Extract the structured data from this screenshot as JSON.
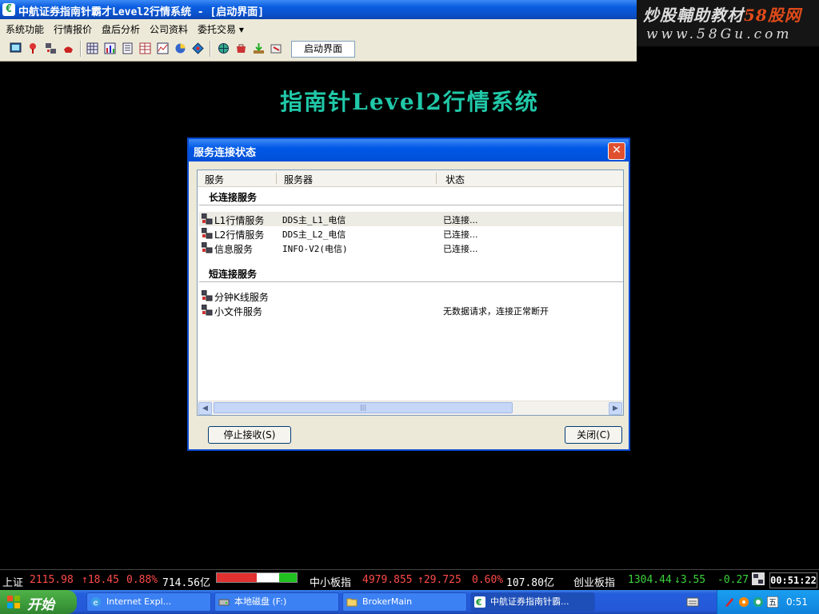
{
  "window": {
    "title": "中航证券指南针霸才Level2行情系统 - [启动界面]",
    "watermark_line1": "炒股輔助教材",
    "watermark_brand": "58股网",
    "watermark_line2": "www.58Gu.com"
  },
  "menu": [
    "系统功能",
    "行情报价",
    "盘后分析",
    "公司资料",
    "委托交易 ▾"
  ],
  "toolbar": {
    "field_value": "启动界面"
  },
  "main": {
    "headline": "指南针Level2行情系统"
  },
  "dialog": {
    "title": "服务连接状态",
    "columns": [
      "服务",
      "服务器",
      "状态"
    ],
    "groups": [
      {
        "label": "长连接服务",
        "rows": [
          {
            "name": "L1行情服务",
            "server": "DDS主_L1_电信",
            "status": "已连接..."
          },
          {
            "name": "L2行情服务",
            "server": "DDS主_L2_电信",
            "status": "已连接..."
          },
          {
            "name": "信息服务",
            "server": "INFO-V2(电信)",
            "status": "已连接..."
          }
        ]
      },
      {
        "label": "短连接服务",
        "rows": [
          {
            "name": "分钟K线服务",
            "server": "",
            "status": ""
          },
          {
            "name": "小文件服务",
            "server": "",
            "status": "无数据请求，连接正常断开"
          }
        ]
      }
    ],
    "stop_button": "停止接收(S)",
    "close_button": "关闭(C)"
  },
  "ticker": {
    "sh_label": "上证",
    "sh_index": "2115.98",
    "sh_change": "↑18.45",
    "sh_pct": "0.88%",
    "sh_amount": "714.56亿",
    "sme_label": "中小板指",
    "sme_index": "4979.855",
    "sme_change": "↑29.725",
    "sme_pct": "0.60%",
    "sme_amount": "107.80亿",
    "gem_label": "创业板指",
    "gem_index": "1304.44",
    "gem_change": "↓3.55",
    "gem_pct": "-0.27",
    "clock": "00:51:22",
    "breadth": {
      "up": 0.5,
      "flat": 0.28,
      "down": 0.22
    }
  },
  "taskbar": {
    "start_label": "开始",
    "tasks": [
      "Internet Expl...",
      "本地磁盘 (F:)",
      "BrokerMain",
      "中航证券指南针霸..."
    ],
    "time": "0:51"
  },
  "colors": {
    "accent": "#0a5ee0",
    "headline": "#20c8a8",
    "up": "#ff4a4a",
    "down": "#3cd43c"
  }
}
